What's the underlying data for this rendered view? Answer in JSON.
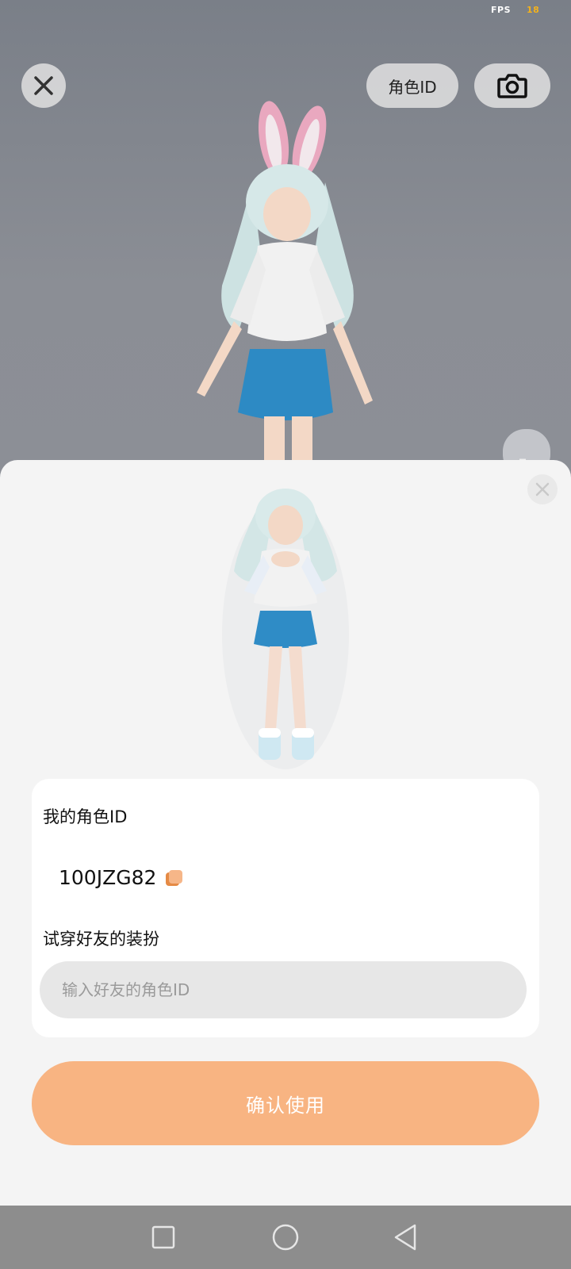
{
  "status": {
    "fps_label": "FPS",
    "fps_value": "18"
  },
  "top_bar": {
    "role_id_button": "角色ID"
  },
  "panel": {
    "my_id_label": "我的角色ID",
    "my_id_value": "100JZG82",
    "try_on_label": "试穿好友的装扮",
    "friend_id_placeholder": "输入好友的角色ID",
    "friend_id_value": "",
    "confirm_button": "确认使用"
  },
  "colors": {
    "accent": "#f8b482",
    "panel_bg": "#f4f4f4",
    "card_bg": "#ffffff",
    "input_bg": "#e7e7e7",
    "copy_icon": "#f0a060"
  },
  "icons": {
    "close_top": "close-icon",
    "camera": "camera-icon",
    "side": "rotate-icon",
    "sheet_close": "close-icon",
    "copy": "copy-icon",
    "nav_recents": "square-icon",
    "nav_home": "circle-icon",
    "nav_back": "triangle-back-icon"
  }
}
